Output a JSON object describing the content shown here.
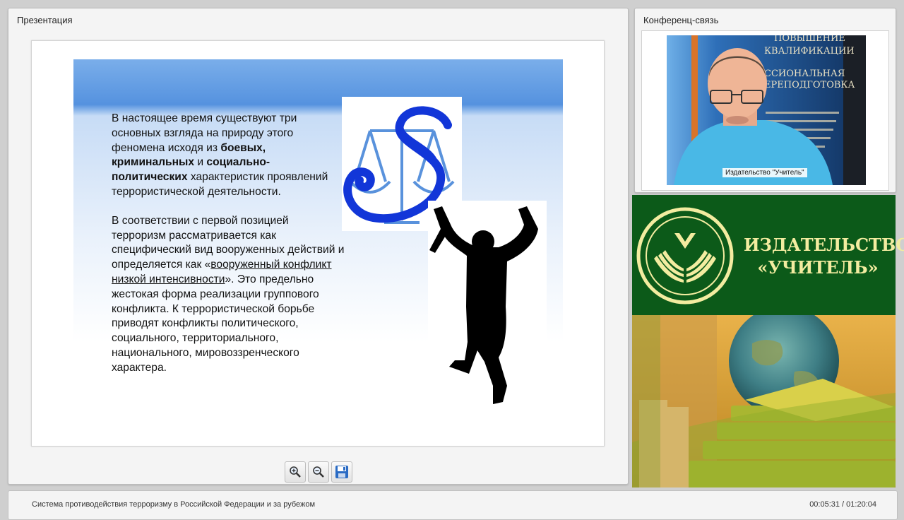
{
  "presentation": {
    "title": "Презентация",
    "slide": {
      "p1_a": "В настоящее время существуют три основных взгляда на природу этого феномена исходя из ",
      "p1_b1": "боевых, криминальных",
      "p1_c": " и ",
      "p1_b2": "социально-политических",
      "p1_d": " характеристик проявлений террористической деятельности.",
      "p2_a": "В соответствии с первой позицией терроризм рассматривается как специфический вид вооруженных действий и определяется как «",
      "p2_u": "вооруженный конфликт низкой интенсивности",
      "p2_b": "». Это предельно жестокая форма реализации группового конфликта. К террористической борьбе приводят конфликты политического, социального, территориального, национального, мировоззренческого характера."
    },
    "toolbar": {
      "zoom_in_icon": "zoom-in-icon",
      "zoom_out_icon": "zoom-out-icon",
      "save_icon": "floppy-disk-icon"
    }
  },
  "conference": {
    "title": "Конференц-связь",
    "video_caption": "Издательство \"Учитель\"",
    "backdrop_lines": [
      "ПОВЫШЕНИЕ",
      "КВАЛИФИКАЦИИ",
      "ССИОНАЛЬНАЯ",
      "ЕРЕПОДГОТОВКА"
    ]
  },
  "banner": {
    "line1": "ИЗДАТЕЛЬСТВО",
    "line2": "«УЧИТЕЛЬ»",
    "bg_color": "#0c5a19",
    "text_color": "#f3eca0"
  },
  "footer": {
    "course_title": "Система противодействия терроризму в Российской Федерации и за рубежом",
    "time": "00:05:31 / 01:20:04"
  }
}
